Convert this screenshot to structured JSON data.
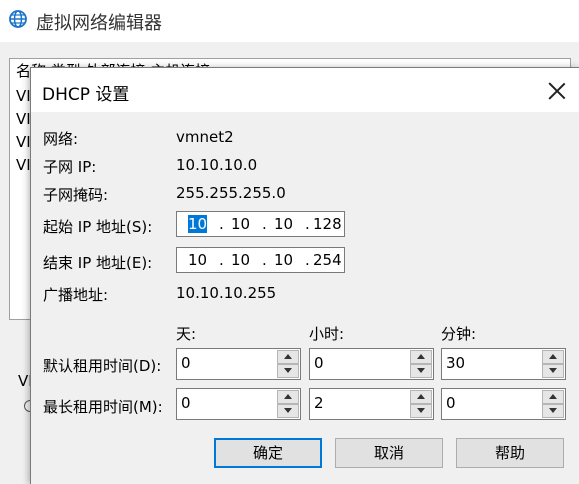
{
  "parent_window": {
    "title": "虚拟网络编辑器",
    "list_header": "名称      类型      外部连接                    主机连接",
    "list_rows": [
      "VI",
      "VI",
      "VI",
      "VI"
    ],
    "vm_fragment": "VI"
  },
  "dialog": {
    "title": "DHCP 设置",
    "network_label": "网络:",
    "network_value": "vmnet2",
    "subnet_ip_label": "子网 IP:",
    "subnet_ip_value": "10.10.10.0",
    "subnet_mask_label": "子网掩码:",
    "subnet_mask_value": "255.255.255.0",
    "start_ip_label": "起始 IP 地址(S):",
    "start_ip": [
      "10",
      "10",
      "10",
      "128"
    ],
    "end_ip_label": "结束 IP 地址(E):",
    "end_ip": [
      "10",
      "10",
      "10",
      "254"
    ],
    "broadcast_label": "广播地址:",
    "broadcast_value": "10.10.10.255",
    "col_days": "天:",
    "col_hours": "小时:",
    "col_minutes": "分钟:",
    "default_lease_label": "默认租用时间(D):",
    "default_lease": {
      "days": "0",
      "hours": "0",
      "minutes": "30"
    },
    "max_lease_label": "最长租用时间(M):",
    "max_lease": {
      "days": "0",
      "hours": "2",
      "minutes": "0"
    },
    "ok_label": "确定",
    "cancel_label": "取消",
    "help_label": "帮助",
    "ip_dot": "."
  },
  "colors": {
    "accent": "#0078d7",
    "titlebar": "#ffffff",
    "window_bg": "#f0f0f0"
  }
}
